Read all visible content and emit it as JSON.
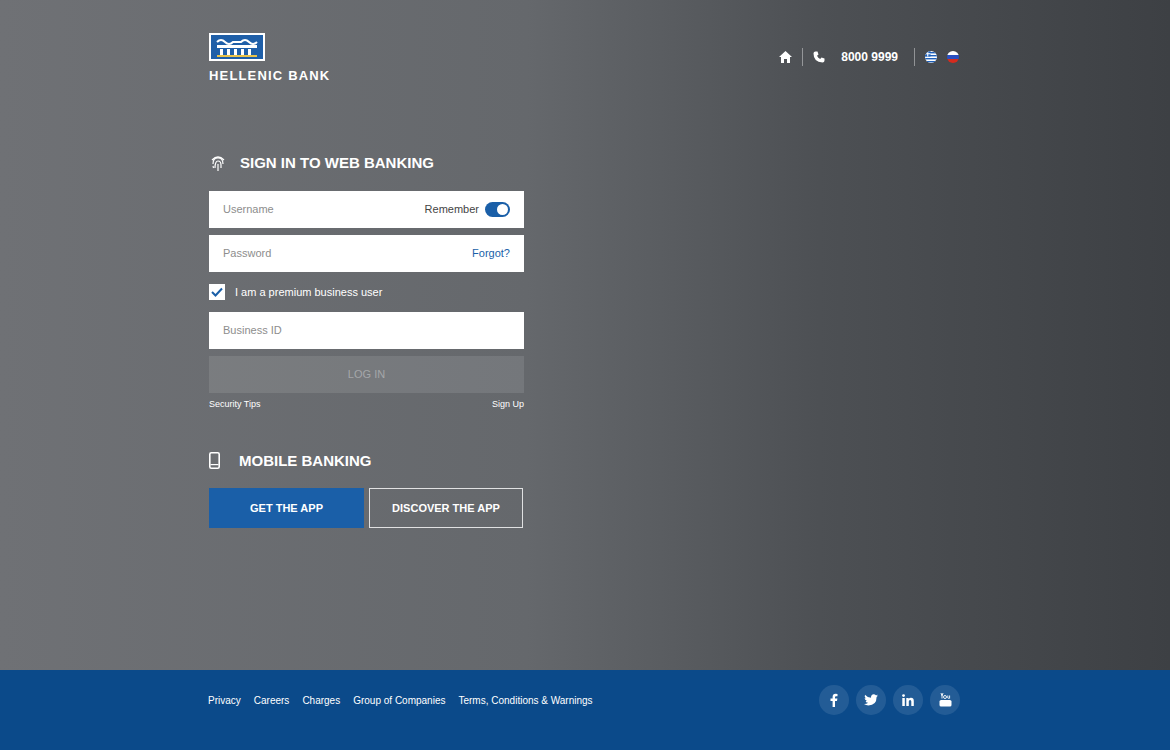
{
  "header": {
    "logo": "HELLENIC BANK",
    "phone": "8000 9999"
  },
  "signin": {
    "title": "SIGN IN TO WEB BANKING",
    "username_placeholder": "Username",
    "remember_label": "Remember",
    "remember_on": true,
    "password_placeholder": "Password",
    "forgot": "Forgot?",
    "premium_label": "I am a premium business user",
    "premium_checked": true,
    "business_id_placeholder": "Business ID",
    "login": "LOG IN",
    "login_disabled": true,
    "security_tips": "Security Tips",
    "sign_up": "Sign Up"
  },
  "mobile": {
    "title": "MOBILE BANKING",
    "buttons": [
      {
        "label": "GET THE APP",
        "kind": "filled"
      },
      {
        "label": "DISCOVER THE APP",
        "kind": "outline"
      }
    ]
  },
  "footer": {
    "links": [
      "Privacy",
      "Careers",
      "Charges",
      "Group of Companies",
      "Terms, Conditions & Warnings"
    ]
  }
}
